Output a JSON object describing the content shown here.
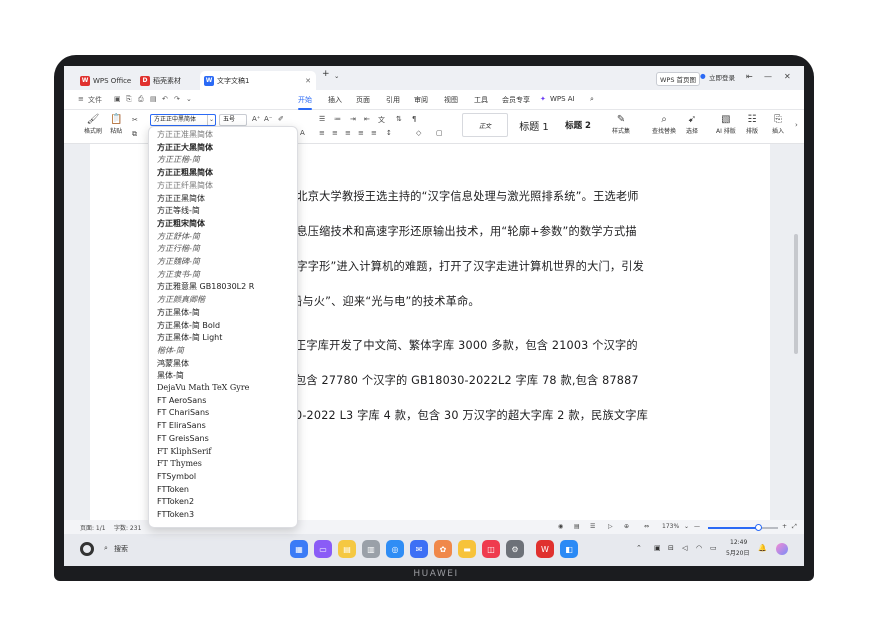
{
  "device": {
    "brand": "HUAWEI"
  },
  "titlebar": {
    "tabs": [
      {
        "label": "WPS Office",
        "logo": "W",
        "color": "#e0312e"
      },
      {
        "label": "稻壳素材",
        "logo": "D",
        "color": "#e0312e"
      },
      {
        "label": "文字文稿1",
        "logo": "W",
        "color": "#2b6af5"
      }
    ],
    "new_tab": "+",
    "more": "⌄",
    "btn_wps_homepage": "WPS 首页图",
    "login": "立即登录",
    "pin": "⇤",
    "minimize": "—",
    "close": "✕"
  },
  "menubar": {
    "file": "文件",
    "items": [
      "开始",
      "插入",
      "页面",
      "引用",
      "审阅",
      "视图",
      "工具",
      "会员专享",
      "WPS AI"
    ],
    "active": "开始",
    "search_icon": "search-icon"
  },
  "ribbon": {
    "format_painter": "格式刷",
    "paste": "粘贴",
    "font_name": "方正正中黑简体",
    "font_size": "五号",
    "styles": [
      {
        "label": "正文"
      },
      {
        "label": "标题 1"
      },
      {
        "label": "标题 2"
      }
    ],
    "style_set": "样式集",
    "find_replace": "查找替换",
    "select": "选择",
    "ai_layout": "AI 排版",
    "layout": "排版",
    "insert": "插入"
  },
  "document": {
    "lines": [
      "于北京大学教授王选主持的“汉字信息处理与激光照排系统”。王选老师",
      "信息压缩技术和高速字形还原输出技术，用“轮廓+参数”的数学方式描",
      "汉字字形”进入计算机的难题，打开了汉字走进计算机世界的大门，引发",
      "“铅与火”、迎来“光与电”的技术革命。",
      "正字库开发了中文简、繁体字库 3000 多款，包含 21003 个汉字的",
      "包含 27780 个汉字的 GB18030-2022L2 字库 78 款,包含 87887",
      "0-2022 L3 字库 4 款，包含 30 万汉字的超大字库 2 款，民族文字库"
    ]
  },
  "font_dropdown": {
    "items": [
      {
        "label": "方正正准黑简体",
        "style": "light"
      },
      {
        "label": "方正正大黑简体",
        "style": "b"
      },
      {
        "label": "方正正楷-简",
        "style": "i"
      },
      {
        "label": "方正正粗黑简体",
        "style": "b"
      },
      {
        "label": "方正正纤黑简体",
        "style": "light"
      },
      {
        "label": "方正正黑简体",
        "style": ""
      },
      {
        "label": "方正等线-简",
        "style": ""
      },
      {
        "label": "方正粗宋简体",
        "style": "b"
      },
      {
        "label": "方正舒体-简",
        "style": "i"
      },
      {
        "label": "方正行楷-简",
        "style": "i"
      },
      {
        "label": "方正魏碑-简",
        "style": "i"
      },
      {
        "label": "方正隶书-简",
        "style": "i"
      },
      {
        "label": "方正雅意黑 GB18030L2 R",
        "style": ""
      },
      {
        "label": "方正颜真卿楷",
        "style": "i"
      },
      {
        "label": "方正黑体-简",
        "style": ""
      },
      {
        "label": "方正黑体-简 Bold",
        "style": ""
      },
      {
        "label": "方正黑体-简 Light",
        "style": ""
      },
      {
        "label": "楷体-简",
        "style": "i"
      },
      {
        "label": "鸿蒙黑体",
        "style": ""
      },
      {
        "label": "黑体-简",
        "style": ""
      },
      {
        "label": "DejaVu Math TeX Gyre",
        "style": "serif"
      },
      {
        "label": "FT AeroSans",
        "style": ""
      },
      {
        "label": "FT ChariSans",
        "style": ""
      },
      {
        "label": "FT EliraSans",
        "style": ""
      },
      {
        "label": "FT GreisSans",
        "style": ""
      },
      {
        "label": "FT KliphSerif",
        "style": "serif"
      },
      {
        "label": "FT Thymes",
        "style": "serif"
      },
      {
        "label": "FTSymbol",
        "style": ""
      },
      {
        "label": "FTToken",
        "style": ""
      },
      {
        "label": "FTToken2",
        "style": ""
      },
      {
        "label": "FTToken3",
        "style": ""
      }
    ]
  },
  "statusbar": {
    "page": "页面: 1/1",
    "words": "字数: 231",
    "zoom": "173%",
    "zoom_minus": "—",
    "zoom_plus": "+"
  },
  "taskbar": {
    "search": "搜索",
    "time": "12:49",
    "date": "5月20日"
  },
  "colors": {
    "accent": "#2b6af5",
    "wps_red": "#e0312e"
  }
}
